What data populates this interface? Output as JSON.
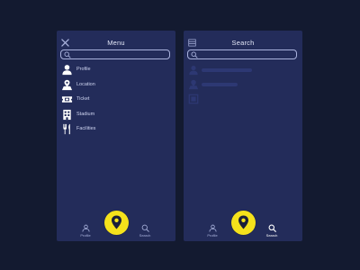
{
  "colors": {
    "background": "#131a30",
    "panel": "#232c5a",
    "accent": "#f5e21b",
    "text": "#e3e7f7",
    "muted": "#aab3dd"
  },
  "menu_screen": {
    "title": "Menu",
    "header_icon": "close-icon",
    "search": {
      "value": "",
      "placeholder": "",
      "icon": "search-icon"
    },
    "items": [
      {
        "label": "Profile",
        "icon": "user-icon"
      },
      {
        "label": "Location",
        "icon": "map-icon"
      },
      {
        "label": "Ticket",
        "icon": "ticket-icon"
      },
      {
        "label": "Stadium",
        "icon": "stadium-icon"
      },
      {
        "label": "Facilities",
        "icon": "fork-knife-icon"
      }
    ],
    "tabs": [
      {
        "label": "Profile",
        "icon": "user-icon",
        "active": false
      },
      {
        "label": "Search",
        "icon": "search-icon",
        "active": false
      }
    ],
    "fab_icon": "location-pin-icon"
  },
  "search_screen": {
    "title": "Search",
    "header_icon": "menu-icon",
    "search": {
      "value": "",
      "placeholder": "",
      "icon": "search-icon"
    },
    "tabs": [
      {
        "label": "Profile",
        "icon": "user-icon",
        "active": false
      },
      {
        "label": "Search",
        "icon": "search-icon",
        "active": true
      }
    ],
    "fab_icon": "location-pin-icon"
  }
}
